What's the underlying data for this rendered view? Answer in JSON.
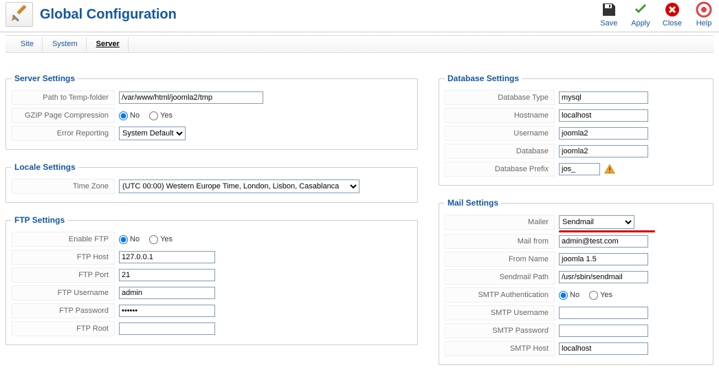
{
  "header": {
    "title": "Global Configuration"
  },
  "toolbar": {
    "save": "Save",
    "apply": "Apply",
    "close": "Close",
    "help": "Help"
  },
  "tabs": {
    "site": "Site",
    "system": "System",
    "server": "Server"
  },
  "server_settings": {
    "legend": "Server Settings",
    "path_label": "Path to Temp-folder",
    "path_value": "/var/www/html/joomla2/tmp",
    "gzip_label": "GZIP Page Compression",
    "gzip_no": "No",
    "gzip_yes": "Yes",
    "error_label": "Error Reporting",
    "error_value": "System Default"
  },
  "locale_settings": {
    "legend": "Locale Settings",
    "tz_label": "Time Zone",
    "tz_value": "(UTC 00:00) Western Europe Time, London, Lisbon, Casablanca"
  },
  "ftp_settings": {
    "legend": "FTP Settings",
    "enable_label": "Enable FTP",
    "enable_no": "No",
    "enable_yes": "Yes",
    "host_label": "FTP Host",
    "host_value": "127.0.0.1",
    "port_label": "FTP Port",
    "port_value": "21",
    "user_label": "FTP Username",
    "user_value": "admin",
    "pass_label": "FTP Password",
    "pass_value": "••••••",
    "root_label": "FTP Root",
    "root_value": ""
  },
  "db_settings": {
    "legend": "Database Settings",
    "type_label": "Database Type",
    "type_value": "mysql",
    "host_label": "Hostname",
    "host_value": "localhost",
    "user_label": "Username",
    "user_value": "joomla2",
    "db_label": "Database",
    "db_value": "joomla2",
    "prefix_label": "Database Prefix",
    "prefix_value": "jos_"
  },
  "mail_settings": {
    "legend": "Mail Settings",
    "mailer_label": "Mailer",
    "mailer_value": "Sendmail",
    "from_label": "Mail from",
    "from_value": "admin@test.com",
    "name_label": "From Name",
    "name_value": "joomla 1.5",
    "sendmail_label": "Sendmail Path",
    "sendmail_value": "/usr/sbin/sendmail",
    "smtpauth_label": "SMTP Authentication",
    "smtpauth_no": "No",
    "smtpauth_yes": "Yes",
    "smtpuser_label": "SMTP Username",
    "smtpuser_value": "",
    "smtppass_label": "SMTP Password",
    "smtppass_value": "",
    "smtphost_label": "SMTP Host",
    "smtphost_value": "localhost"
  }
}
